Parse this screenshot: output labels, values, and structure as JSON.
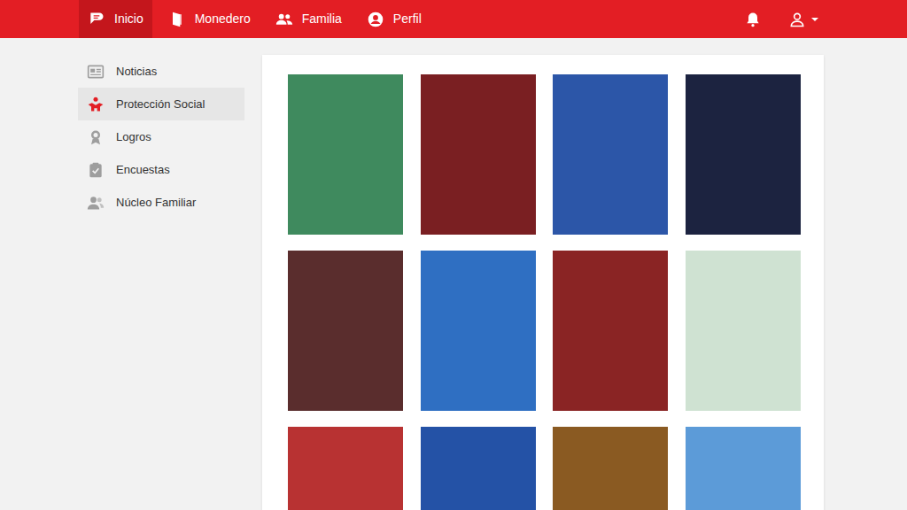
{
  "navbar": {
    "items": [
      {
        "label": "Inicio",
        "selected": true,
        "icon": "logo"
      },
      {
        "label": "Monedero",
        "selected": false,
        "icon": "wallet"
      },
      {
        "label": "Familia",
        "selected": false,
        "icon": "family"
      },
      {
        "label": "Perfil",
        "selected": false,
        "icon": "profile"
      }
    ]
  },
  "sidebar": {
    "items": [
      {
        "label": "Noticias",
        "selected": false,
        "icon": "news"
      },
      {
        "label": "Protección Social",
        "selected": true,
        "icon": "social"
      },
      {
        "label": "Logros",
        "selected": false,
        "icon": "medal"
      },
      {
        "label": "Encuestas",
        "selected": false,
        "icon": "survey"
      },
      {
        "label": "Núcleo Familiar",
        "selected": false,
        "icon": "people"
      }
    ]
  },
  "tiles": [
    {
      "color": "#3f8a5e"
    },
    {
      "color": "#7a1f22"
    },
    {
      "color": "#2c56a8"
    },
    {
      "color": "#1c2340"
    },
    {
      "color": "#5a2d2d"
    },
    {
      "color": "#2f6fc2"
    },
    {
      "color": "#8a2424"
    },
    {
      "color": "#cfe2d2"
    },
    {
      "color": "#b83232"
    },
    {
      "color": "#2452a6"
    },
    {
      "color": "#8a5a22"
    },
    {
      "color": "#5c9bd8"
    }
  ]
}
